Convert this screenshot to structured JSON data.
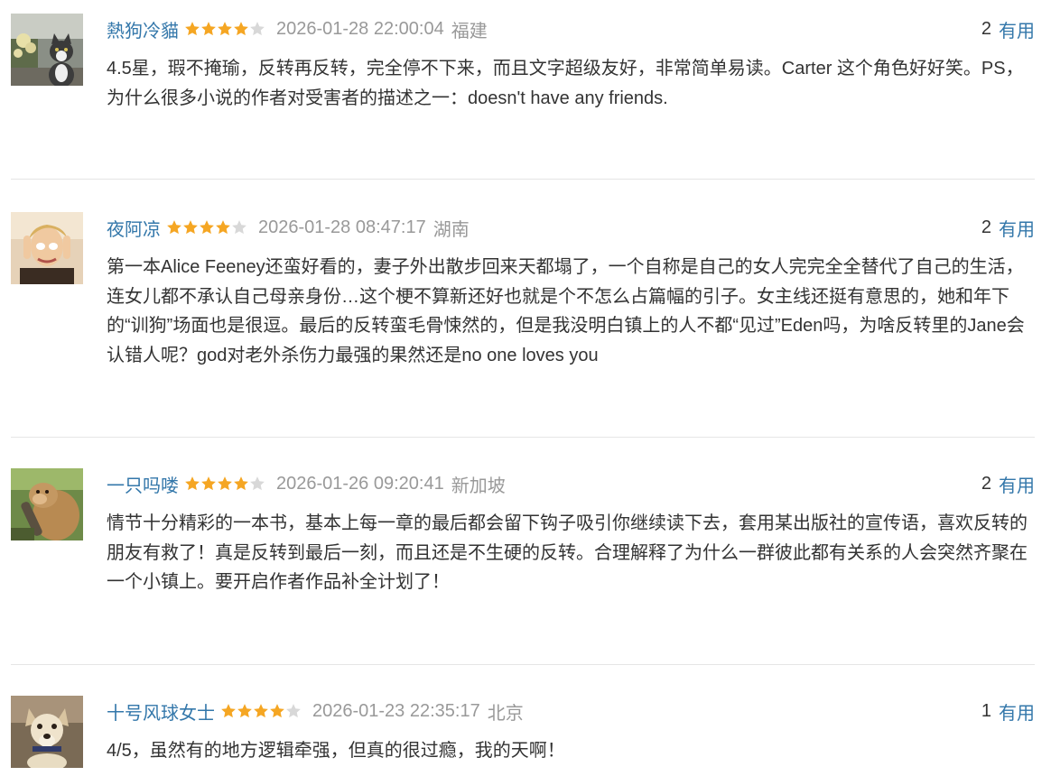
{
  "colors": {
    "username": "#3377aa",
    "star_filled": "#f5a623",
    "star_empty": "#d8d8d8",
    "meta": "#999999",
    "text": "#333333",
    "divider": "#e5e5e5"
  },
  "reviews": [
    {
      "user": "熱狗冷貓",
      "rating": 4,
      "max_rating": 5,
      "time": "2026-01-28 22:00:04",
      "location": "福建",
      "useful_count": "2",
      "useful_label": "有用",
      "avatar_icon": "cat-photo-avatar",
      "content": "4.5星，瑕不掩瑜，反转再反转，完全停不下来，而且文字超级友好，非常简单易读。Carter 这个角色好好笑。PS，为什么很多小说的作者对受害者的描述之一：doesn't have any friends."
    },
    {
      "user": "夜阿凉",
      "rating": 4,
      "max_rating": 5,
      "time": "2026-01-28 08:47:17",
      "location": "湖南",
      "useful_count": "2",
      "useful_label": "有用",
      "avatar_icon": "person-photo-avatar",
      "content": "第一本Alice Feeney还蛮好看的，妻子外出散步回来天都塌了，一个自称是自己的女人完完全全替代了自己的生活，连女儿都不承认自己母亲身份…这个梗不算新还好也就是个不怎么占篇幅的引子。女主线还挺有意思的，她和年下的“训狗”场面也是很逗。最后的反转蛮毛骨悚然的，但是我没明白镇上的人不都“见过”Eden吗，为啥反转里的Jane会认错人呢？god对老外杀伤力最强的果然还是no one loves you"
    },
    {
      "user": "一只吗喽",
      "rating": 4,
      "max_rating": 5,
      "time": "2026-01-26 09:20:41",
      "location": "新加坡",
      "useful_count": "2",
      "useful_label": "有用",
      "avatar_icon": "monkey-photo-avatar",
      "content": "情节十分精彩的一本书，基本上每一章的最后都会留下钩子吸引你继续读下去，套用某出版社的宣传语，喜欢反转的朋友有救了！真是反转到最后一刻，而且还是不生硬的反转。合理解释了为什么一群彼此都有关系的人会突然齐聚在一个小镇上。要开启作者作品补全计划了！"
    },
    {
      "user": "十号风球女士",
      "rating": 4,
      "max_rating": 5,
      "time": "2026-01-23 22:35:17",
      "location": "北京",
      "useful_count": "1",
      "useful_label": "有用",
      "avatar_icon": "dog-photo-avatar",
      "content": "4/5，虽然有的地方逻辑牵强，但真的很过瘾，我的天啊！"
    }
  ]
}
